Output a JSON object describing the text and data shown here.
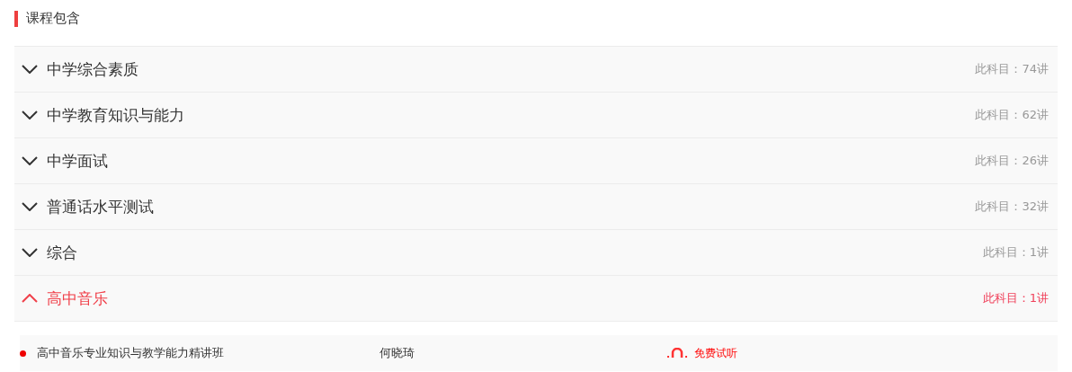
{
  "section_title": "课程包含",
  "subjects": [
    {
      "name": "中学综合素质",
      "count": "此科目：74讲",
      "expanded": false
    },
    {
      "name": "中学教育知识与能力",
      "count": "此科目：62讲",
      "expanded": false
    },
    {
      "name": "中学面试",
      "count": "此科目：26讲",
      "expanded": false
    },
    {
      "name": "普通话水平测试",
      "count": "此科目：32讲",
      "expanded": false
    },
    {
      "name": "综合",
      "count": "此科目：1讲",
      "expanded": false
    },
    {
      "name": "高中音乐",
      "count": "此科目：1讲",
      "expanded": true,
      "children": [
        {
          "title": "高中音乐专业知识与教学能力精讲班",
          "teacher": "何晓琦",
          "action": "免费试听"
        }
      ]
    }
  ]
}
